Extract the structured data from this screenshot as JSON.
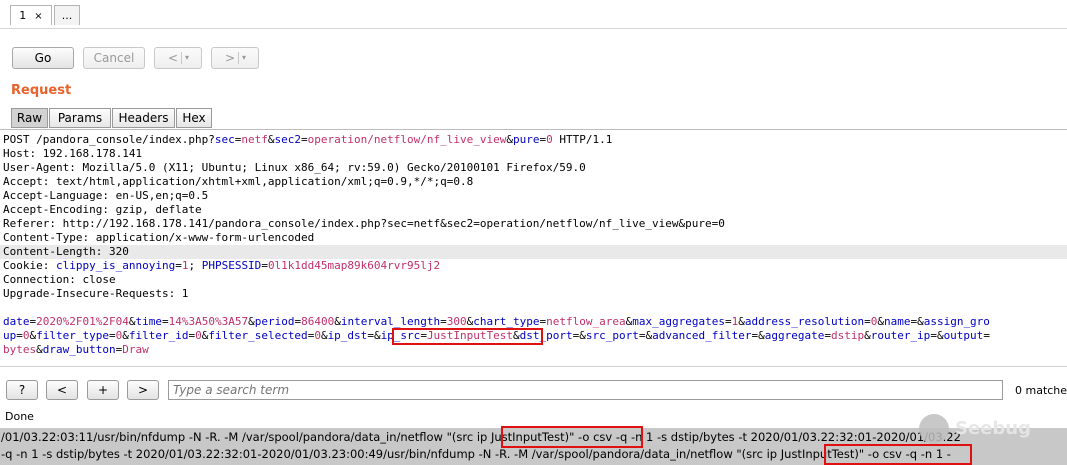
{
  "tabs": [
    {
      "label": "1",
      "active": true
    },
    {
      "label": "...",
      "active": false
    }
  ],
  "tab_close_icon": "×",
  "toolbar": {
    "go": "Go",
    "cancel": "Cancel",
    "back_icon": "<",
    "forward_icon": ">",
    "dropdown_icon": "▾"
  },
  "request": {
    "title": "Request",
    "subtabs": [
      "Raw",
      "Params",
      "Headers",
      "Hex"
    ],
    "active_subtab": "Raw",
    "lines": [
      [
        [
          "POST /pandora_console/index.php?",
          ""
        ],
        [
          "sec",
          "k"
        ],
        [
          "=",
          ""
        ],
        [
          "netf",
          "v"
        ],
        [
          "&",
          ""
        ],
        [
          "sec2",
          "k"
        ],
        [
          "=",
          ""
        ],
        [
          "operation/netflow/nf_live_view",
          "v"
        ],
        [
          "&",
          ""
        ],
        [
          "pure",
          "k"
        ],
        [
          "=",
          ""
        ],
        [
          "0",
          "v"
        ],
        [
          " HTTP/1.1",
          ""
        ]
      ],
      [
        [
          "Host: 192.168.178.141",
          ""
        ]
      ],
      [
        [
          "User-Agent: Mozilla/5.0 (X11; Ubuntu; Linux x86_64; rv:59.0) Gecko/20100101 Firefox/59.0",
          ""
        ]
      ],
      [
        [
          "Accept: text/html,application/xhtml+xml,application/xml;q=0.9,*/*;q=0.8",
          ""
        ]
      ],
      [
        [
          "Accept-Language: en-US,en;q=0.5",
          ""
        ]
      ],
      [
        [
          "Accept-Encoding: gzip, deflate",
          ""
        ]
      ],
      [
        [
          "Referer: http://192.168.178.141/pandora_console/index.php?sec=netf&sec2=operation/netflow/nf_live_view&pure=0",
          ""
        ]
      ],
      [
        [
          "Content-Type: application/x-www-form-urlencoded",
          ""
        ]
      ],
      [
        [
          "Content-Length: 320",
          ""
        ]
      ],
      [
        [
          "Cookie: ",
          ""
        ],
        [
          "clippy_is_annoying",
          "k"
        ],
        [
          "=",
          ""
        ],
        [
          "1",
          "v"
        ],
        [
          "; ",
          ""
        ],
        [
          "PHPSESSID",
          "k"
        ],
        [
          "=",
          ""
        ],
        [
          "0l1k1dd45map89k604rvr95lj2",
          "v"
        ]
      ],
      [
        [
          "Connection: close",
          ""
        ]
      ],
      [
        [
          "Upgrade-Insecure-Requests: 1",
          ""
        ]
      ],
      [],
      [
        [
          "date",
          "k"
        ],
        [
          "=",
          ""
        ],
        [
          "2020%2F01%2F04",
          "v"
        ],
        [
          "&",
          ""
        ],
        [
          "time",
          "k"
        ],
        [
          "=",
          ""
        ],
        [
          "14%3A50%3A57",
          "v"
        ],
        [
          "&",
          ""
        ],
        [
          "period",
          "k"
        ],
        [
          "=",
          ""
        ],
        [
          "86400",
          "v"
        ],
        [
          "&",
          ""
        ],
        [
          "interval_length",
          "k"
        ],
        [
          "=",
          ""
        ],
        [
          "300",
          "v"
        ],
        [
          "&",
          ""
        ],
        [
          "chart_type",
          "k"
        ],
        [
          "=",
          ""
        ],
        [
          "netflow_area",
          "v"
        ],
        [
          "&",
          ""
        ],
        [
          "max_aggregates",
          "k"
        ],
        [
          "=",
          ""
        ],
        [
          "1",
          "v"
        ],
        [
          "&",
          ""
        ],
        [
          "address_resolution",
          "k"
        ],
        [
          "=",
          ""
        ],
        [
          "0",
          "v"
        ],
        [
          "&",
          ""
        ],
        [
          "name",
          "k"
        ],
        [
          "=",
          ""
        ],
        [
          "&",
          ""
        ],
        [
          "assign_gro",
          "k"
        ]
      ],
      [
        [
          "up",
          "k"
        ],
        [
          "=",
          ""
        ],
        [
          "0",
          "v"
        ],
        [
          "&",
          ""
        ],
        [
          "filter_type",
          "k"
        ],
        [
          "=",
          ""
        ],
        [
          "0",
          "v"
        ],
        [
          "&",
          ""
        ],
        [
          "filter_id",
          "k"
        ],
        [
          "=",
          ""
        ],
        [
          "0",
          "v"
        ],
        [
          "&",
          ""
        ],
        [
          "filter_selected",
          "k"
        ],
        [
          "=",
          ""
        ],
        [
          "0",
          "v"
        ],
        [
          "&",
          ""
        ],
        [
          "ip_dst",
          "k"
        ],
        [
          "=",
          ""
        ],
        [
          "&",
          ""
        ],
        [
          "ip_src",
          "k"
        ],
        [
          "=",
          ""
        ],
        [
          "JustInputTest",
          "v"
        ],
        [
          "&",
          ""
        ],
        [
          "dst_port",
          "k"
        ],
        [
          "=",
          ""
        ],
        [
          "&",
          ""
        ],
        [
          "src_port",
          "k"
        ],
        [
          "=",
          ""
        ],
        [
          "&",
          ""
        ],
        [
          "advanced_filter",
          "k"
        ],
        [
          "=",
          ""
        ],
        [
          "&",
          ""
        ],
        [
          "aggregate",
          "k"
        ],
        [
          "=",
          ""
        ],
        [
          "dstip",
          "v"
        ],
        [
          "&",
          ""
        ],
        [
          "router_ip",
          "k"
        ],
        [
          "=",
          ""
        ],
        [
          "&",
          ""
        ],
        [
          "output",
          "k"
        ],
        [
          "=",
          ""
        ]
      ],
      [
        [
          "bytes",
          "v"
        ],
        [
          "&",
          ""
        ],
        [
          "draw_button",
          "k"
        ],
        [
          "=",
          ""
        ],
        [
          "Draw",
          "v"
        ]
      ]
    ]
  },
  "search": {
    "help": "?",
    "prev": "<",
    "add": "+",
    "next": ">",
    "placeholder": "Type a search term",
    "matches": "0 matche"
  },
  "status": "Done",
  "log_lines": [
    "/01/03.22:03:11/usr/bin/nfdump -N -R. -M /var/spool/pandora/data_in/netflow \"(src ip JustInputTest)\" -o csv -q -n 1 -s dstip/bytes -t 2020/01/03.22:32:01-2020/01/03.22",
    "-q -n 1 -s dstip/bytes -t 2020/01/03.22:32:01-2020/01/03.23:00:49/usr/bin/nfdump -N -R. -M /var/spool/pandora/data_in/netflow \"(src ip JustInputTest)\" -o csv -q -n 1 -"
  ],
  "watermark": "Seebug"
}
